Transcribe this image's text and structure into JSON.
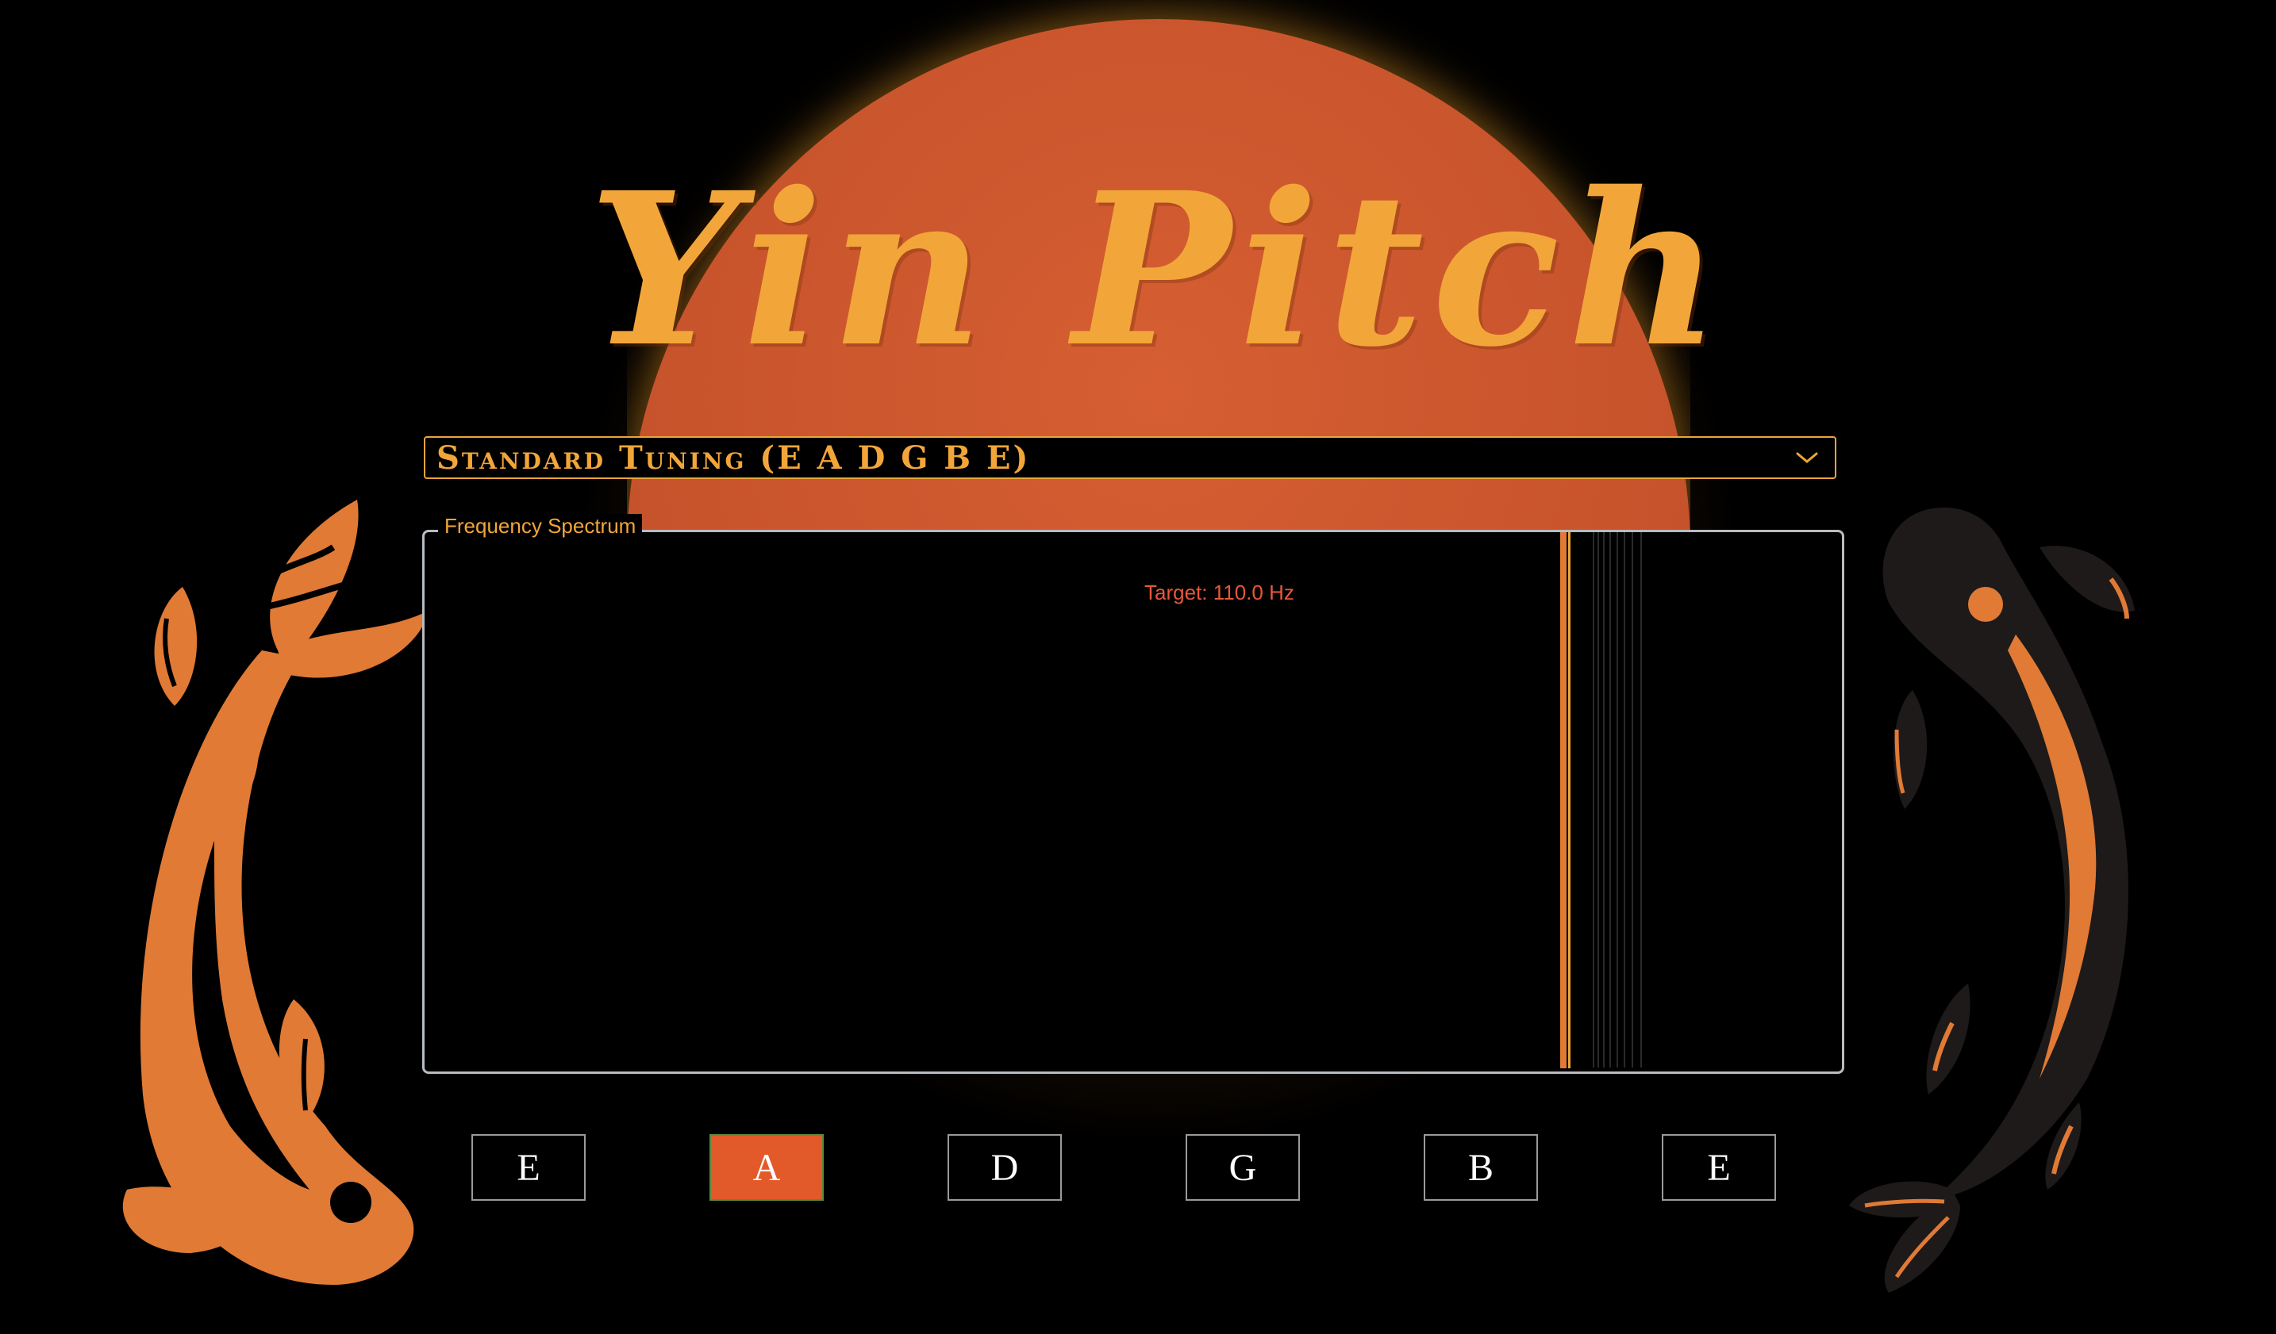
{
  "app": {
    "title": "Yin Pitch"
  },
  "tuning": {
    "selected": "Standard Tuning (E A D G B E)"
  },
  "spectrum": {
    "legend": "Frequency Spectrum",
    "target_label": "Target: 110.0 Hz"
  },
  "strings": [
    {
      "label": "E",
      "active": false
    },
    {
      "label": "A",
      "active": true
    },
    {
      "label": "D",
      "active": false
    },
    {
      "label": "G",
      "active": false
    },
    {
      "label": "B",
      "active": false
    },
    {
      "label": "E",
      "active": false
    }
  ],
  "colors": {
    "accent": "#f2a63a",
    "sun": "#c8542c",
    "active_string": "#e35a2a",
    "target": "#e9573a",
    "fish_orange": "#e07a35",
    "fish_dark": "#1e1a1a"
  },
  "icons": {
    "dropdown": "chevron-down-icon",
    "left_fish": "koi-orange-icon",
    "right_fish": "koi-black-icon"
  }
}
